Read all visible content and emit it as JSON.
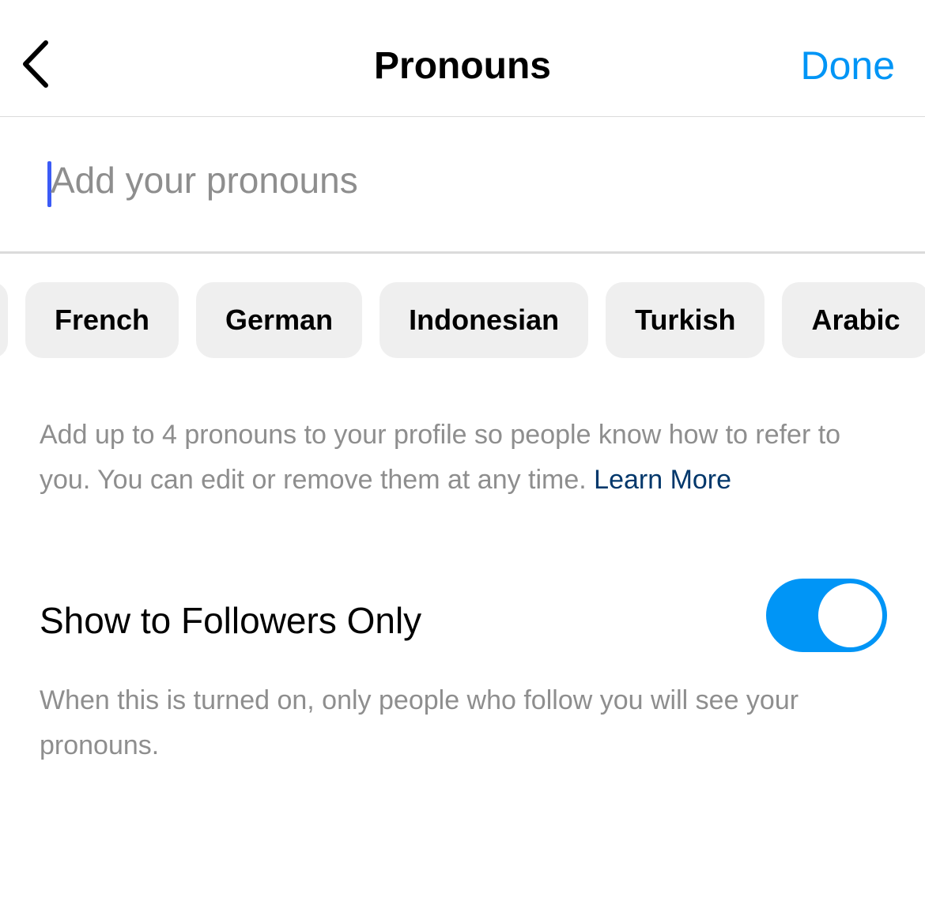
{
  "header": {
    "title": "Pronouns",
    "done_label": "Done",
    "back_icon": "chevron-left-icon"
  },
  "input": {
    "placeholder": "Add your pronouns",
    "value": ""
  },
  "languages": [
    "French",
    "German",
    "Indonesian",
    "Turkish",
    "Arabic"
  ],
  "description": {
    "text": "Add up to 4 pronouns to your profile so people know how to refer to you. You can edit or remove them at any time. ",
    "link": "Learn More"
  },
  "followers_only": {
    "label": "Show to Followers Only",
    "enabled": true,
    "help": "When this is turned on, only people who follow you will see your pronouns."
  },
  "colors": {
    "accent": "#0095f6",
    "link": "#00376b"
  }
}
